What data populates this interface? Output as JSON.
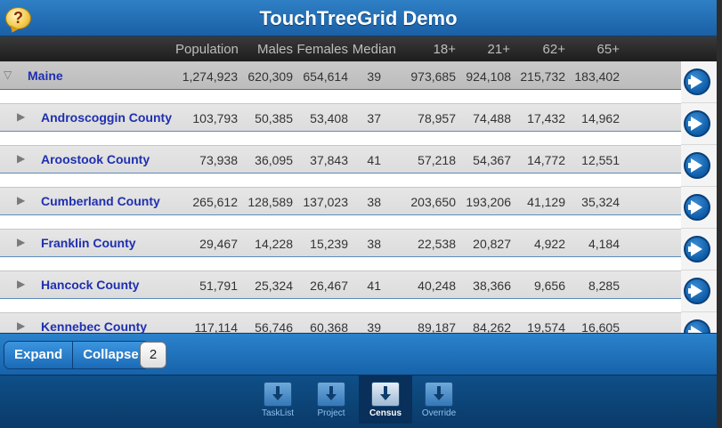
{
  "app": {
    "title": "TouchTreeGrid Demo",
    "help_label": "?"
  },
  "columns": [
    "Population",
    "Males",
    "Females",
    "Median",
    "18+",
    "21+",
    "62+",
    "65+"
  ],
  "parent_row": {
    "toggle": "▽",
    "name": "Maine",
    "values": [
      "1,274,923",
      "620,309",
      "654,614",
      "39",
      "973,685",
      "924,108",
      "215,732",
      "183,402"
    ]
  },
  "child_rows": [
    {
      "toggle": "▶",
      "name": "Androscoggin County",
      "values": [
        "103,793",
        "50,385",
        "53,408",
        "37",
        "78,957",
        "74,488",
        "17,432",
        "14,962"
      ]
    },
    {
      "toggle": "▶",
      "name": "Aroostook County",
      "values": [
        "73,938",
        "36,095",
        "37,843",
        "41",
        "57,218",
        "54,367",
        "14,772",
        "12,551"
      ]
    },
    {
      "toggle": "▶",
      "name": "Cumberland County",
      "values": [
        "265,612",
        "128,589",
        "137,023",
        "38",
        "203,650",
        "193,206",
        "41,129",
        "35,324"
      ]
    },
    {
      "toggle": "▶",
      "name": "Franklin County",
      "values": [
        "29,467",
        "14,228",
        "15,239",
        "38",
        "22,538",
        "20,827",
        "4,922",
        "4,184"
      ]
    },
    {
      "toggle": "▶",
      "name": "Hancock County",
      "values": [
        "51,791",
        "25,324",
        "26,467",
        "41",
        "40,248",
        "38,366",
        "9,656",
        "8,285"
      ]
    },
    {
      "toggle": "▶",
      "name": "Kennebec County",
      "values": [
        "117,114",
        "56,746",
        "60,368",
        "39",
        "89,187",
        "84,262",
        "19,574",
        "16,605"
      ]
    }
  ],
  "toolbar": {
    "expand_label": "Expand",
    "collapse_label": "Collapse",
    "level": "2"
  },
  "tabs": [
    {
      "label": "TaskList",
      "active": false
    },
    {
      "label": "Project",
      "active": false
    },
    {
      "label": "Census",
      "active": true
    },
    {
      "label": "Override",
      "active": false
    }
  ],
  "colors": {
    "accent": "#1a60a6",
    "link": "#1f2fb0"
  }
}
